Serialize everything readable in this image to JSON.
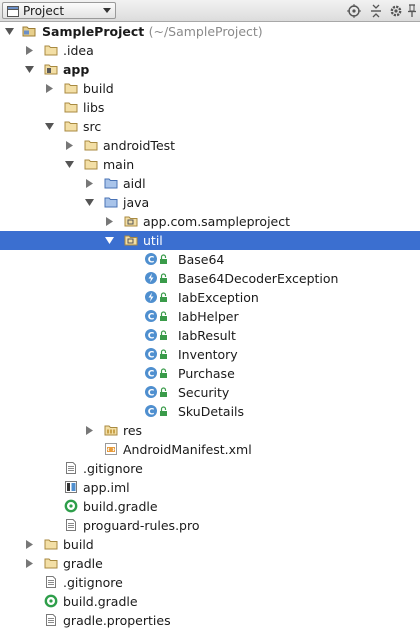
{
  "toolbar": {
    "view_label": "Project",
    "icons": [
      "target-icon",
      "collapse-all-icon",
      "gear-icon",
      "pin-icon"
    ]
  },
  "tree": {
    "root": "SampleProject",
    "root_path": "(~/SampleProject)",
    "idea": ".idea",
    "app": "app",
    "app_build": "build",
    "libs": "libs",
    "src": "src",
    "androidTest": "androidTest",
    "main": "main",
    "aidl": "aidl",
    "java": "java",
    "pkg": "app.com.sampleproject",
    "util": "util",
    "classes": [
      {
        "name": "Base64",
        "kind": "class"
      },
      {
        "name": "Base64DecoderException",
        "kind": "exception"
      },
      {
        "name": "IabException",
        "kind": "exception"
      },
      {
        "name": "IabHelper",
        "kind": "class"
      },
      {
        "name": "IabResult",
        "kind": "class"
      },
      {
        "name": "Inventory",
        "kind": "class"
      },
      {
        "name": "Purchase",
        "kind": "class"
      },
      {
        "name": "Security",
        "kind": "class"
      },
      {
        "name": "SkuDetails",
        "kind": "class"
      }
    ],
    "res": "res",
    "manifest": "AndroidManifest.xml",
    "app_gitignore": ".gitignore",
    "app_iml": "app.iml",
    "app_build_gradle": "build.gradle",
    "proguard": "proguard-rules.pro",
    "root_build": "build",
    "gradle": "gradle",
    "root_gitignore": ".gitignore",
    "root_build_gradle": "build.gradle",
    "gradle_properties": "gradle.properties"
  },
  "colors": {
    "selection": "#3b6fd0",
    "folder": "#d9b46a",
    "source_folder": "#5b8fd6",
    "class_badge": "#4f8fcf",
    "gradle": "#2e9e4a"
  }
}
